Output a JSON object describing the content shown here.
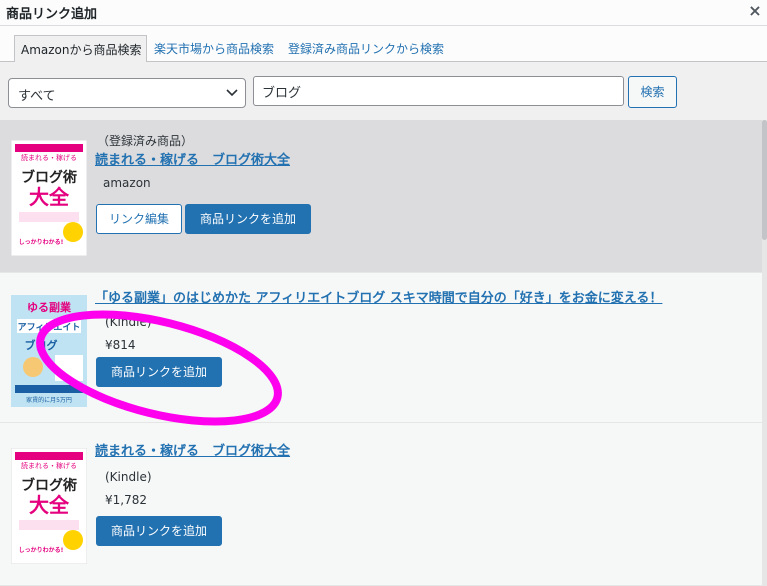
{
  "dialog": {
    "title": "商品リンク追加",
    "close_label": "×"
  },
  "tabs": [
    {
      "label": "Amazonから商品検索",
      "active": true
    },
    {
      "label": "楽天市場から商品検索",
      "active": false
    },
    {
      "label": "登録済み商品リンクから検索",
      "active": false
    }
  ],
  "search": {
    "category_value": "すべて",
    "keyword_value": "ブログ",
    "button_label": "検索"
  },
  "results": [
    {
      "status": "（登録済み商品）",
      "title": "読まれる・稼げる　ブログ術大全",
      "source": "amazon",
      "edit_label": "リンク編集",
      "add_label": "商品リンクを追加",
      "cover": {
        "top_text": "読まれる・稼げる",
        "main1": "ブログ術",
        "main2": "大全",
        "bottom_text": "しっかりわかる!"
      }
    },
    {
      "status": "(Kindle)",
      "title": "「ゆる副業」のはじめかた アフィリエイトブログ スキマ時間で自分の「好き」をお金に変える！",
      "price": "¥814",
      "add_label": "商品リンクを追加",
      "cover": {
        "top_text": "ゆる副業",
        "main1": "アフィリエイト",
        "main2": "ブログ",
        "bottom_text": "家賃的に月5万円"
      }
    },
    {
      "status": "(Kindle)",
      "title": "読まれる・稼げる　ブログ術大全",
      "price": "¥1,782",
      "add_label": "商品リンクを追加",
      "cover": {
        "top_text": "読まれる・稼げる",
        "main1": "ブログ術",
        "main2": "大全",
        "bottom_text": "しっかりわかる!"
      }
    }
  ],
  "colors": {
    "accent": "#2271b1",
    "annotation": "#ff00ee",
    "cover_pink": "#e4007f"
  }
}
